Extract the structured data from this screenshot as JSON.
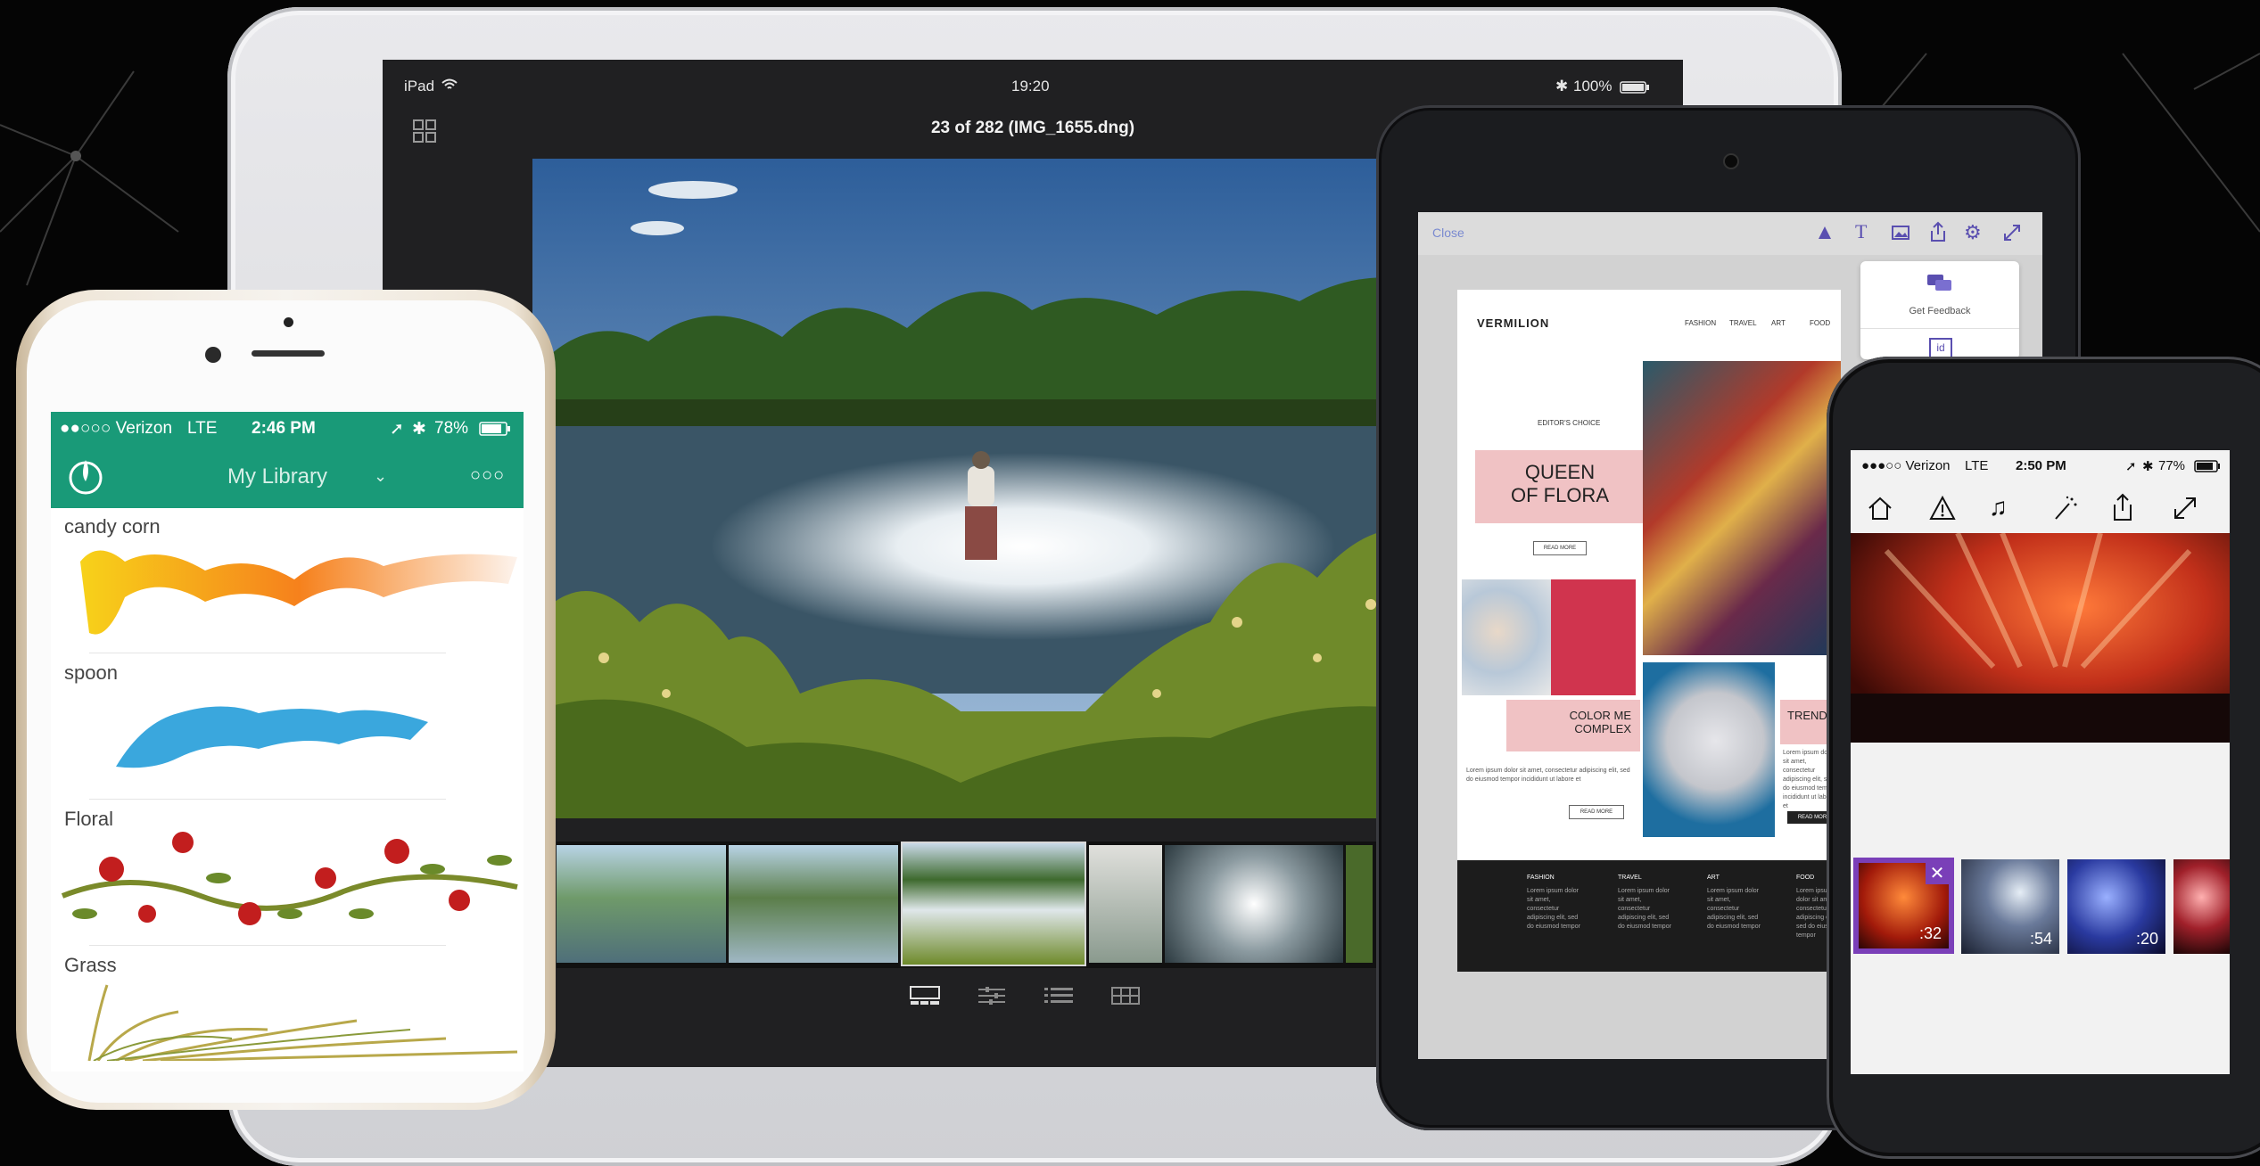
{
  "ipad_lightroom": {
    "status": {
      "carrier": "iPad",
      "time": "19:20",
      "battery": "100%"
    },
    "title": "23 of 282 (IMG_1655.dng)",
    "icons": [
      "grid-icon",
      "wifi-icon",
      "bluetooth-icon",
      "battery-icon",
      "filmstrip-view-icon",
      "adjust-sliders-icon",
      "list-icon",
      "crop-grid-icon"
    ]
  },
  "ipad_editor": {
    "toolbar": {
      "close_label": "Close",
      "icons": [
        "theme-icon",
        "text-icon",
        "image-icon",
        "share-icon",
        "settings-icon",
        "fullscreen-icon"
      ]
    },
    "popover": {
      "feedback_label": "Get Feedback",
      "id_label": "id"
    },
    "site": {
      "brand": "VERMILION",
      "nav": [
        "FASHION",
        "TRAVEL",
        "ART",
        "FOOD"
      ],
      "editors_choice": "EDITOR'S CHOICE",
      "hero_title_1": "QUEEN",
      "hero_title_2": "OF FLORA",
      "read_more": "READ MORE",
      "color_me_1": "COLOR ME",
      "color_me_2": "COMPLEX",
      "trend": "TREND",
      "lorem": "Lorem ipsum dolor sit amet, consectetur adipiscing elit, sed do eiusmod tempor incididunt ut labore et",
      "footer_cols": [
        "FASHION",
        "TRAVEL",
        "ART",
        "FOOD"
      ],
      "footer_text": "Lorem ipsum dolor sit amet, consectetur adipiscing elit, sed do eiusmod tempor"
    }
  },
  "iphone_brush": {
    "status": {
      "carrier": "●●○○○ Verizon",
      "network": "LTE",
      "time": "2:46 PM",
      "battery": "78%"
    },
    "nav": {
      "title": "My Library",
      "more": "○○○"
    },
    "brushes": [
      "candy corn",
      "spoon",
      "Floral",
      "Grass"
    ],
    "accent": "#199a78"
  },
  "iphone_clip": {
    "status": {
      "carrier": "●●●○○ Verizon",
      "network": "LTE",
      "time": "2:50 PM",
      "battery": "77%"
    },
    "toolbar_icons": [
      "home-icon",
      "warning-icon",
      "music-icon",
      "magic-wand-icon",
      "share-icon",
      "expand-icon"
    ],
    "clips": [
      ":32",
      ":54",
      ":20"
    ],
    "accent": "#7a3fb8"
  }
}
